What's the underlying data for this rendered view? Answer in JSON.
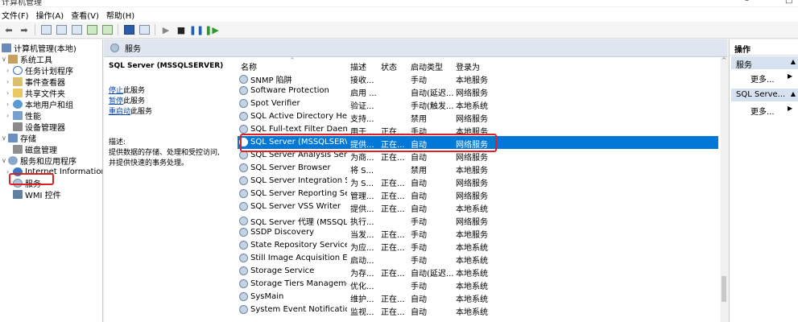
{
  "window": {
    "title": "计算机管理"
  },
  "menu": [
    "文件(F)",
    "操作(A)",
    "查看(V)",
    "帮助(H)"
  ],
  "tree": {
    "root": "计算机管理(本地)",
    "items": [
      {
        "label": "系统工具"
      },
      {
        "label": "任务计划程序"
      },
      {
        "label": "事件查看器"
      },
      {
        "label": "共享文件夹"
      },
      {
        "label": "本地用户和组"
      },
      {
        "label": "性能"
      },
      {
        "label": "设备管理器"
      },
      {
        "label": "存储"
      },
      {
        "label": "磁盘管理"
      },
      {
        "label": "服务和应用程序"
      },
      {
        "label": "Internet Information Se"
      },
      {
        "label": "服务"
      },
      {
        "label": "WMI 控件"
      }
    ]
  },
  "center": {
    "header": "服务",
    "selected_service": "SQL Server (MSSQLSERVER)",
    "links": {
      "stop": "停止",
      "stop_suffix": "此服务",
      "pause": "暂停",
      "pause_suffix": "此服务",
      "restart": "重启动",
      "restart_suffix": "此服务"
    },
    "desc_label": "描述:",
    "desc_line1": "提供数据的存储、处理和受控访问,",
    "desc_line2": "并提供快速的事务处理。"
  },
  "table": {
    "columns": [
      "名称",
      "描述",
      "状态",
      "启动类型",
      "登录为"
    ],
    "rows": [
      [
        "SNMP 陷阱",
        "接收...",
        "",
        "手动",
        "本地服务"
      ],
      [
        "Software Protection",
        "启用 ...",
        "",
        "自动(延迟...",
        "网络服务"
      ],
      [
        "Spot Verifier",
        "验证...",
        "",
        "手动(触发...",
        "本地系统"
      ],
      [
        "SQL Active Directory Help...",
        "支持...",
        "",
        "禁用",
        "网络服务"
      ],
      [
        "SQL Full-text Filter Daemo...",
        "用于...",
        "正在...",
        "手动",
        "本地服务"
      ],
      [
        "SQL Server (MSSQLSERVER)",
        "提供...",
        "正在...",
        "自动",
        "网络服务"
      ],
      [
        "SQL Server Analysis Servic...",
        "为商...",
        "正在...",
        "自动",
        "网络服务"
      ],
      [
        "SQL Server Browser",
        "将 S...",
        "",
        "禁用",
        "本地服务"
      ],
      [
        "SQL Server Integration Ser...",
        "为 S...",
        "正在...",
        "自动",
        "网络服务"
      ],
      [
        "SQL Server Reporting Serv...",
        "管理...",
        "正在...",
        "自动",
        "网络服务"
      ],
      [
        "SQL Server VSS Writer",
        "提供...",
        "正在...",
        "自动",
        "本地系统"
      ],
      [
        "SQL Server 代理 (MSSQLS...",
        "执行...",
        "",
        "手动",
        "网络服务"
      ],
      [
        "SSDP Discovery",
        "当发...",
        "正在...",
        "手动",
        "本地服务"
      ],
      [
        "State Repository Service",
        "为应...",
        "正在...",
        "手动",
        "本地系统"
      ],
      [
        "Still Image Acquisition Eve...",
        "启动...",
        "",
        "手动",
        "本地系统"
      ],
      [
        "Storage Service",
        "为存...",
        "正在...",
        "自动(延迟...",
        "本地系统"
      ],
      [
        "Storage Tiers Management",
        "优化...",
        "",
        "手动",
        "本地系统"
      ],
      [
        "SysMain",
        "维护...",
        "正在...",
        "自动",
        "本地系统"
      ],
      [
        "System Event Notification ...",
        "监视...",
        "正在...",
        "自动",
        "本地系统"
      ]
    ]
  },
  "actions": {
    "title": "操作",
    "sections": [
      {
        "label": "服务",
        "more": "更多..."
      },
      {
        "label": "SQL Serve...",
        "more": "更多..."
      }
    ]
  },
  "colors": {
    "selection": "#0078d7",
    "highlight_box": "#e02020"
  }
}
